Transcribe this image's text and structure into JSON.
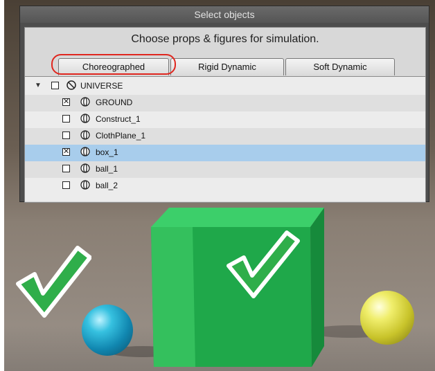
{
  "dialog": {
    "title": "Select objects",
    "subtitle": "Choose props & figures for simulation.",
    "tabs": [
      {
        "label": "Choreographed"
      },
      {
        "label": "Rigid Dynamic"
      },
      {
        "label": "Soft Dynamic"
      }
    ]
  },
  "tree": {
    "root": {
      "label": "UNIVERSE",
      "checked": false,
      "expanded": true
    },
    "items": [
      {
        "label": "GROUND",
        "checked": true
      },
      {
        "label": "Construct_1",
        "checked": false
      },
      {
        "label": "ClothPlane_1",
        "checked": false
      },
      {
        "label": "box_1",
        "checked": true,
        "selected": true
      },
      {
        "label": "ball_1",
        "checked": false
      },
      {
        "label": "ball_2",
        "checked": false
      }
    ]
  },
  "colors": {
    "highlight_ring": "#e0261e",
    "selected_row": "#a8cdec",
    "check_green": "#2fae4a",
    "cube_green": "#1fa84a"
  },
  "icons": {
    "checkmark": "green-check-icon",
    "object": "object-icon",
    "universe": "universe-icon"
  }
}
